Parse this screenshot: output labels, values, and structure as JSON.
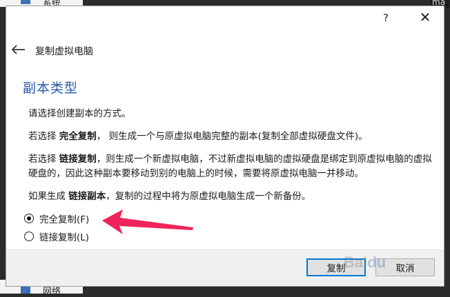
{
  "background": {
    "top_left_fragment": "系统",
    "top_right_fragment": "ma",
    "bottom_left_fragment": "网络"
  },
  "dialog": {
    "help_label": "?",
    "close_label": "✕",
    "back_icon": "back-arrow-icon",
    "header_title": "复制虚拟电脑",
    "section_title": "副本类型",
    "paragraphs": {
      "intro": "请选择创建副本的方式。",
      "full_prefix": "若选择 ",
      "full_bold": "完全复制",
      "full_rest": "， 则生成一个与原虚拟电脑完整的副本(复制全部虚拟硬盘文件)。",
      "linked_prefix": "若选择 ",
      "linked_bold": "链接复制",
      "linked_rest": "，则生成一个新虚拟电脑，不过新虚拟电脑的虚拟硬盘是绑定到原虚拟电脑的虚拟硬盘的，因此这种副本要移动到别的电脑上的时候，需要将原虚拟电脑一并移动。",
      "snap_prefix": "如果生成 ",
      "snap_bold": "链接副本",
      "snap_rest": "，复制的过程中将为原虚拟电脑生成一个新备份。"
    },
    "options": [
      {
        "label": "完全复制(F)",
        "selected": true
      },
      {
        "label": "链接复制(L)",
        "selected": false
      }
    ],
    "buttons": {
      "copy": "复制",
      "cancel": "取消"
    }
  },
  "annotation": {
    "color": "#f0245a"
  },
  "colors": {
    "accent": "#2a5aa8",
    "primary_border": "#0078d7"
  }
}
